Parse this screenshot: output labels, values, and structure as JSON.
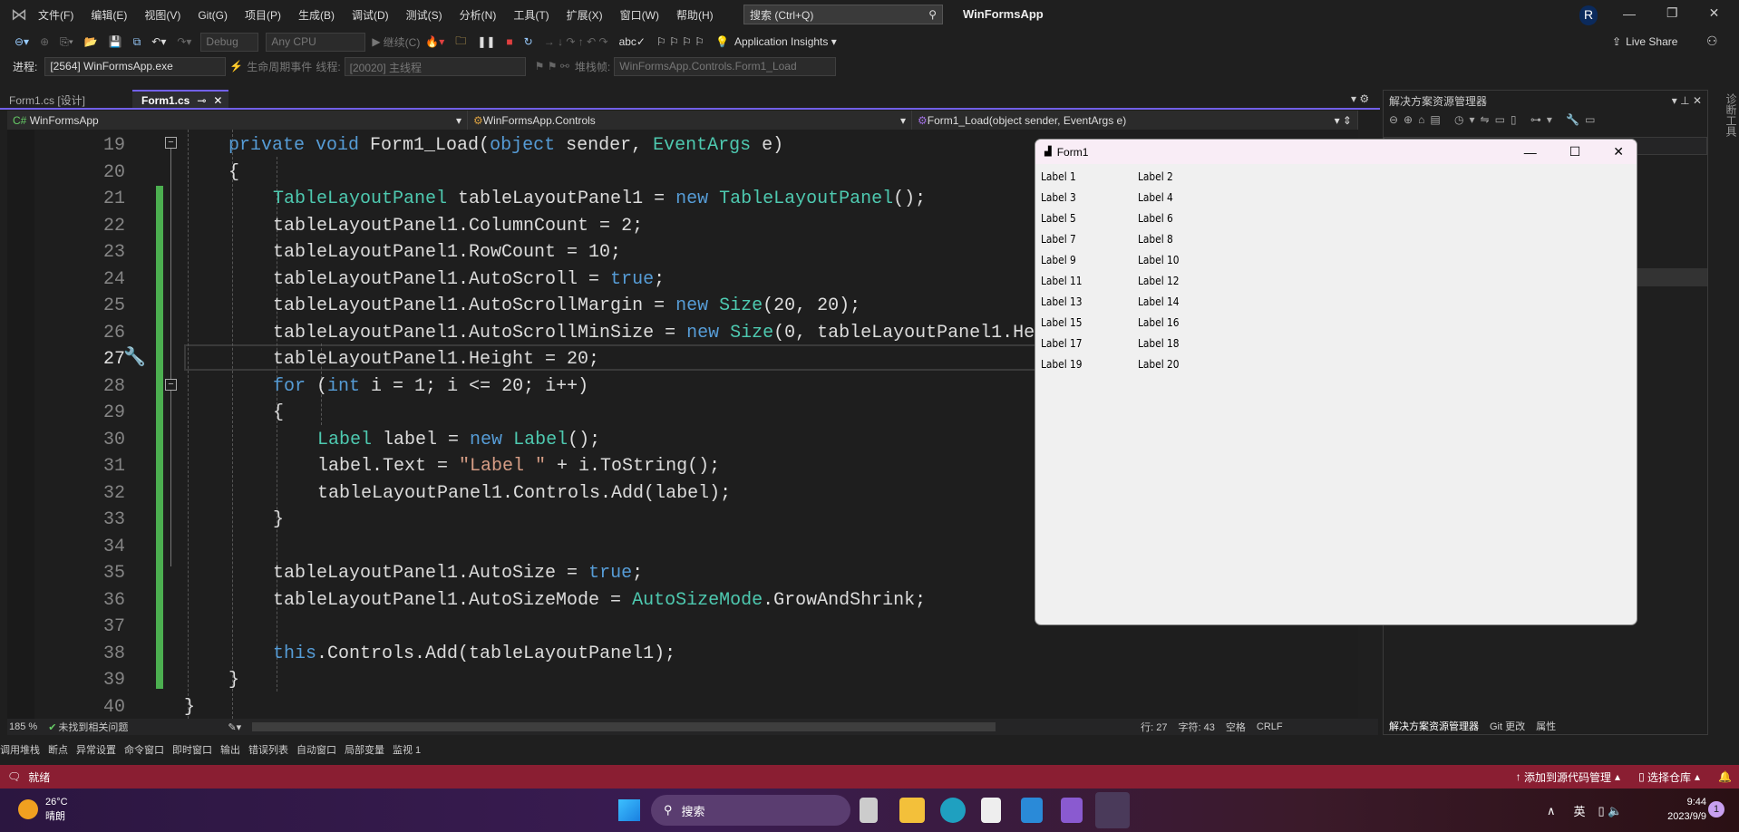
{
  "title": {
    "menu": [
      "文件(F)",
      "编辑(E)",
      "视图(V)",
      "Git(G)",
      "项目(P)",
      "生成(B)",
      "调试(D)",
      "测试(S)",
      "分析(N)",
      "工具(T)",
      "扩展(X)",
      "窗口(W)",
      "帮助(H)"
    ],
    "search_placeholder": "搜索 (Ctrl+Q)",
    "app_name": "WinFormsApp",
    "avatar": "R"
  },
  "toolbar1": {
    "config": "Debug",
    "platform": "Any CPU",
    "continue": "继续(C)",
    "insights": "Application Insights",
    "live_share": "Live Share"
  },
  "toolbar2": {
    "process_label": "进程:",
    "process": "[2564] WinFormsApp.exe",
    "lifecycle": "生命周期事件",
    "thread_label": "线程:",
    "thread": "[20020] 主线程",
    "stack_label": "堆栈帧:",
    "stack": "WinFormsApp.Controls.Form1_Load"
  },
  "tabs": [
    {
      "label": "Form1.cs [设计]"
    },
    {
      "label": "Form1.cs"
    }
  ],
  "navbar": {
    "project": "WinFormsApp",
    "class": "WinFormsApp.Controls",
    "member": "Form1_Load(object sender, EventArgs e)"
  },
  "code": [
    {
      "n": "19",
      "t": [
        [
          "private void ",
          "kw"
        ],
        [
          "Form1_Load(",
          ""
        ],
        [
          "object",
          "kw"
        ],
        [
          " sender, ",
          ""
        ],
        [
          "EventArgs",
          "ty"
        ],
        [
          " e)",
          ""
        ]
      ],
      "i": 1
    },
    {
      "n": "20",
      "t": [
        [
          "{",
          ""
        ]
      ],
      "i": 1
    },
    {
      "n": "21",
      "t": [
        [
          "TableLayoutPanel",
          "ty"
        ],
        [
          " tableLayoutPanel1 = ",
          ""
        ],
        [
          "new ",
          "kw"
        ],
        [
          "TableLayoutPanel",
          "ty"
        ],
        [
          "();",
          ""
        ]
      ],
      "i": 2
    },
    {
      "n": "22",
      "t": [
        [
          "tableLayoutPanel1.ColumnCount = 2;",
          ""
        ]
      ],
      "i": 2
    },
    {
      "n": "23",
      "t": [
        [
          "tableLayoutPanel1.RowCount = 10;",
          ""
        ]
      ],
      "i": 2
    },
    {
      "n": "24",
      "t": [
        [
          "tableLayoutPanel1.AutoScroll = ",
          ""
        ],
        [
          "true",
          "kw"
        ],
        [
          ";",
          ""
        ]
      ],
      "i": 2
    },
    {
      "n": "25",
      "t": [
        [
          "tableLayoutPanel1.AutoScrollMargin = ",
          ""
        ],
        [
          "new ",
          "kw"
        ],
        [
          "Size",
          "ty"
        ],
        [
          "(20, 20);",
          ""
        ]
      ],
      "i": 2
    },
    {
      "n": "26",
      "t": [
        [
          "tableLayoutPanel1.AutoScrollMinSize = ",
          ""
        ],
        [
          "new ",
          "kw"
        ],
        [
          "Size",
          "ty"
        ],
        [
          "(0, tableLayoutPanel1.Height);",
          ""
        ]
      ],
      "i": 2
    },
    {
      "n": "27",
      "t": [
        [
          "tableLayoutPanel1.Height = 20;",
          ""
        ]
      ],
      "i": 2
    },
    {
      "n": "28",
      "t": [
        [
          "for ",
          "kw"
        ],
        [
          "(",
          ""
        ],
        [
          "int",
          "kw"
        ],
        [
          " i = 1; i <= 20; i++)",
          ""
        ]
      ],
      "i": 2
    },
    {
      "n": "29",
      "t": [
        [
          "{",
          ""
        ]
      ],
      "i": 2
    },
    {
      "n": "30",
      "t": [
        [
          "Label",
          "ty"
        ],
        [
          " label = ",
          ""
        ],
        [
          "new ",
          "kw"
        ],
        [
          "Label",
          "ty"
        ],
        [
          "();",
          ""
        ]
      ],
      "i": 3
    },
    {
      "n": "31",
      "t": [
        [
          "label.Text = ",
          ""
        ],
        [
          "\"Label \"",
          "st"
        ],
        [
          " + i.ToString();",
          ""
        ]
      ],
      "i": 3
    },
    {
      "n": "32",
      "t": [
        [
          "tableLayoutPanel1.Controls.Add(label);",
          ""
        ]
      ],
      "i": 3
    },
    {
      "n": "33",
      "t": [
        [
          "}",
          ""
        ]
      ],
      "i": 2
    },
    {
      "n": "34",
      "t": [],
      "i": 2
    },
    {
      "n": "35",
      "t": [
        [
          "tableLayoutPanel1.AutoSize = ",
          ""
        ],
        [
          "true",
          "kw"
        ],
        [
          ";",
          ""
        ]
      ],
      "i": 2
    },
    {
      "n": "36",
      "t": [
        [
          "tableLayoutPanel1.AutoSizeMode = ",
          ""
        ],
        [
          "AutoSizeMode",
          "ty"
        ],
        [
          ".GrowAndShrink;",
          ""
        ]
      ],
      "i": 2
    },
    {
      "n": "37",
      "t": [],
      "i": 2
    },
    {
      "n": "38",
      "t": [
        [
          "this",
          "kw"
        ],
        [
          ".Controls.Add(tableLayoutPanel1);",
          ""
        ]
      ],
      "i": 2
    },
    {
      "n": "39",
      "t": [
        [
          "}",
          ""
        ]
      ],
      "i": 1
    },
    {
      "n": "40",
      "t": [
        [
          "}",
          ""
        ]
      ],
      "i": 0
    }
  ],
  "current_line": "27",
  "editor_status": {
    "zoom": "185 %",
    "issues": "未找到相关问题",
    "line": "行: 27",
    "char": "字符: 43",
    "spaces": "空格",
    "eol": "CRLF"
  },
  "solution": {
    "title": "解决方案资源管理器",
    "tabs": [
      "解决方案资源管理器",
      "Git 更改",
      "属性"
    ]
  },
  "right_strip": "诊断工具",
  "tool_windows": [
    "调用堆栈",
    "断点",
    "异常设置",
    "命令窗口",
    "即时窗口",
    "输出",
    "错误列表",
    "自动窗口",
    "局部变量",
    "监视 1"
  ],
  "statusbar": {
    "ready": "就绪",
    "add_source": "添加到源代码管理",
    "select_repo": "选择仓库"
  },
  "form": {
    "title": "Form1",
    "labels": [
      "Label 1",
      "Label 2",
      "Label 3",
      "Label 4",
      "Label 5",
      "Label 6",
      "Label 7",
      "Label 8",
      "Label 9",
      "Label 10",
      "Label 11",
      "Label 12",
      "Label 13",
      "Label 14",
      "Label 15",
      "Label 16",
      "Label 17",
      "Label 18",
      "Label 19",
      "Label 20"
    ]
  },
  "taskbar": {
    "temp": "26°C",
    "weather": "晴朗",
    "search": "搜索",
    "ime": "英",
    "time": "9:44",
    "date": "2023/9/9",
    "notifications": "1"
  },
  "colors": {
    "accent": "#7160e8",
    "status_bar": "#8a1e32",
    "changed_margin": "#4caf50"
  }
}
